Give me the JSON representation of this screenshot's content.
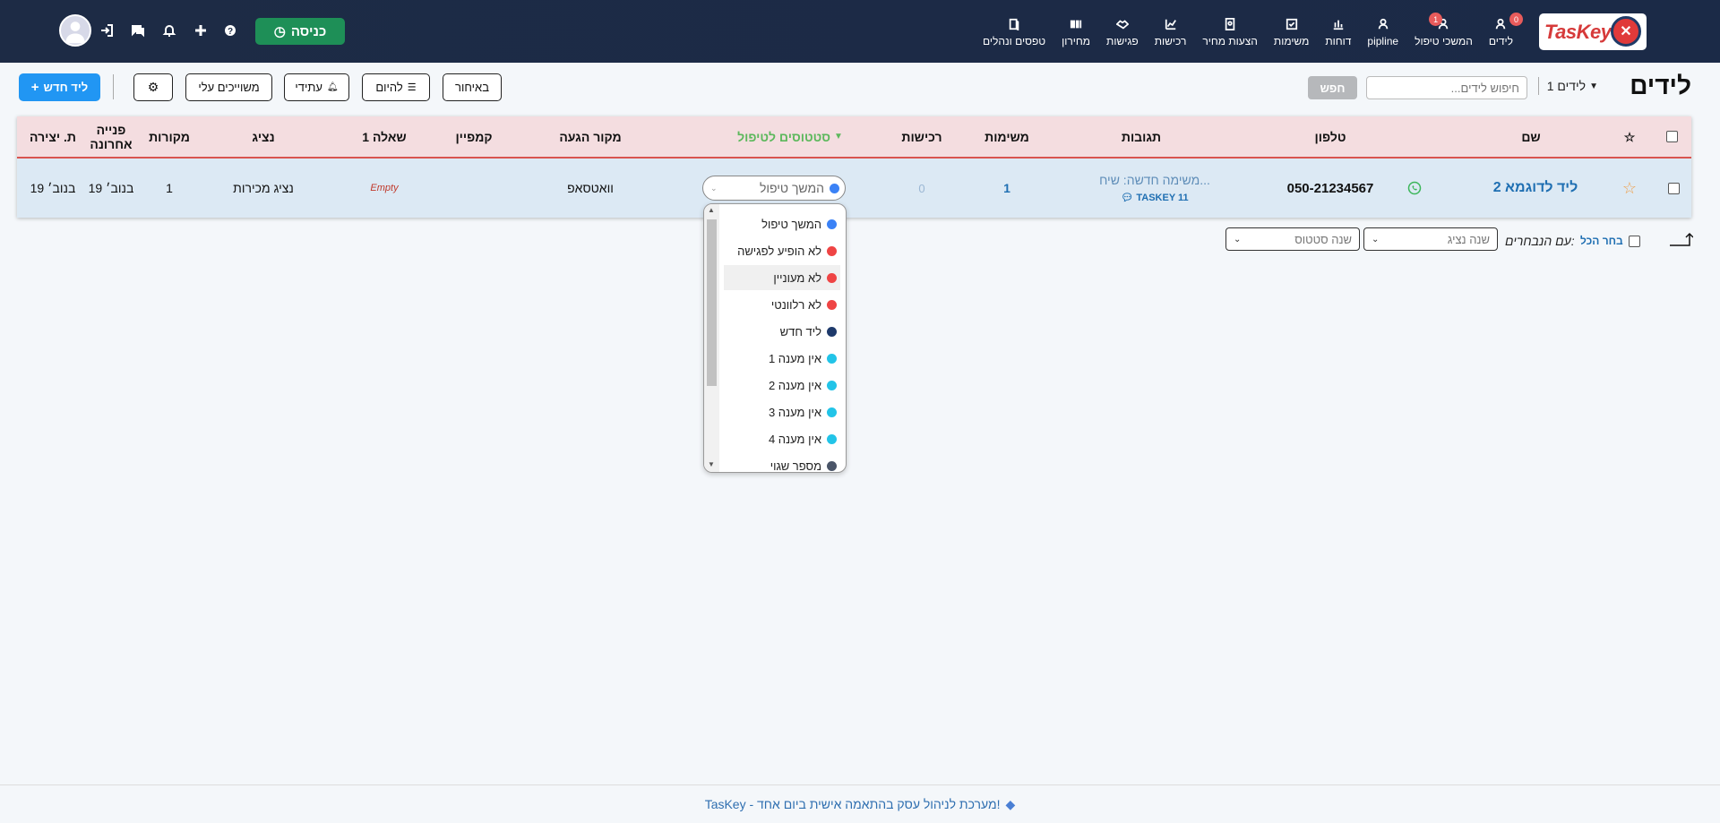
{
  "app": {
    "logo_text": "TasKey",
    "brand_colors": {
      "topbar": "#1d2b45",
      "accent_red": "#d63a3a",
      "link_blue": "#1f6fb2",
      "checkin_green": "#1e8f57",
      "new_lead_blue": "#2196f3"
    }
  },
  "nav": [
    {
      "label": "לידים",
      "icon": "user-icon",
      "badge": "0"
    },
    {
      "label": "המשכי טיפול",
      "icon": "user-icon",
      "badge": "1"
    },
    {
      "label": "pipline",
      "icon": "user-icon",
      "badge": ""
    },
    {
      "label": "דוחות",
      "icon": "bar-chart-icon",
      "badge": ""
    },
    {
      "label": "משימות",
      "icon": "checkbox-icon",
      "badge": ""
    },
    {
      "label": "הצעות מחיר",
      "icon": "document-icon",
      "badge": ""
    },
    {
      "label": "רכישות",
      "icon": "chart-line-icon",
      "badge": ""
    },
    {
      "label": "פגישות",
      "icon": "handshake-icon",
      "badge": ""
    },
    {
      "label": "מחירון",
      "icon": "barcode-icon",
      "badge": ""
    },
    {
      "label": "טפסים ונהלים",
      "icon": "book-icon",
      "badge": ""
    }
  ],
  "topbar": {
    "checkin_label": "כניסה",
    "icons": [
      "help-icon",
      "plus-icon",
      "bell-icon",
      "chat-icon",
      "login-icon"
    ]
  },
  "toolbar": {
    "title": "לידים",
    "leads_count": "1 לידים",
    "search_placeholder": "חיפוש לידים...",
    "search_button": "חפש",
    "buttons": {
      "late": "באיחור",
      "today": "להיום",
      "future": "עתידי",
      "assigned": "משוייכים עלי",
      "new_lead": "ליד חדש"
    }
  },
  "table": {
    "headers": {
      "name": "שם",
      "phone": "טלפון",
      "reactions": "תגובות",
      "tasks": "משימות",
      "purchases": "רכישות",
      "status": "סטטוסים לטיפול",
      "source": "מקור הגעה",
      "campaign": "קמפיין",
      "question1": "שאלה 1",
      "agent": "נציג",
      "sources": "מקורות",
      "last_contact_line1": "פנייה",
      "last_contact_line2": "אחרונה",
      "created": "ת. יצירה"
    },
    "rows": [
      {
        "name": "ליד לדוגמא 2",
        "phone": "050-21234567",
        "reaction_text": "משימה חדשה: שיח...",
        "reaction_sub": "TASKEY 11",
        "tasks": "1",
        "purchases": "0",
        "status": "המשך טיפול",
        "source": "וואטסאפ",
        "campaign": "",
        "question1": "Empty",
        "agent": "נציג מכירות",
        "sources": "1",
        "last_contact": "19 בנוב׳",
        "created": "19 בנוב׳"
      }
    ]
  },
  "status_dropdown": {
    "options": [
      {
        "label": "המשך טיפול",
        "color": "#3b82f6"
      },
      {
        "label": "לא הופיע לפגישה",
        "color": "#ef4444"
      },
      {
        "label": "לא מעוניין",
        "color": "#ef4444"
      },
      {
        "label": "לא רלוונטי",
        "color": "#ef4444"
      },
      {
        "label": "ליד חדש",
        "color": "#1e3a6b"
      },
      {
        "label": "אין מענה 1",
        "color": "#22c4e8"
      },
      {
        "label": "אין מענה 2",
        "color": "#22c4e8"
      },
      {
        "label": "אין מענה 3",
        "color": "#22c4e8"
      },
      {
        "label": "אין מענה 4",
        "color": "#22c4e8"
      },
      {
        "label": "מספר שגוי",
        "color": "#4a5568"
      }
    ],
    "hover_index": 2
  },
  "bulk": {
    "select_all": "בחר הכל",
    "with_selected": "עם הנבחרים:",
    "change_agent": "שנה נציג",
    "change_status": "שנה סטטוס"
  },
  "footer": {
    "text": "TasKey - מערכת לניהול עסק בהתאמה אישית ביום אחד!"
  }
}
